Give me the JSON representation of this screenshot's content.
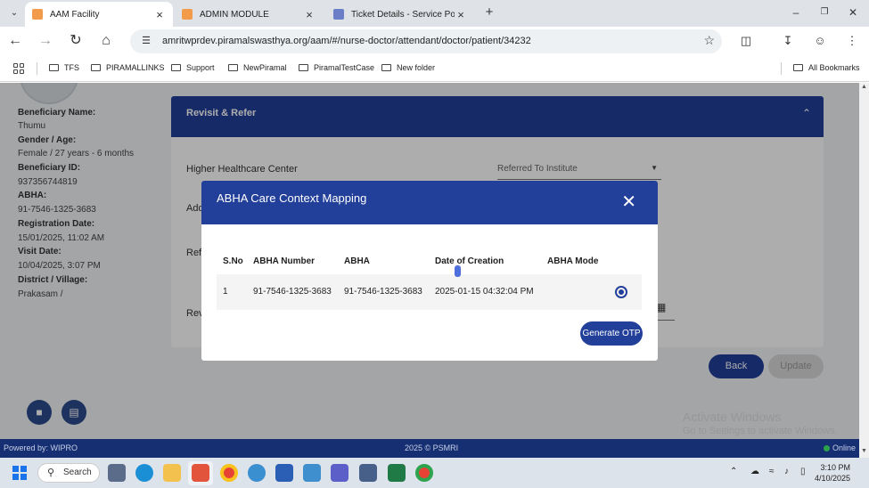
{
  "browser": {
    "tabs": [
      {
        "title": "AAM Facility",
        "active": true
      },
      {
        "title": "ADMIN MODULE",
        "active": false
      },
      {
        "title": "Ticket Details - Service Porta",
        "active": false
      }
    ],
    "url": "amritwprdev.piramalswasthya.org/aam/#/nurse-doctor/attendant/doctor/patient/34232",
    "bookmarks": [
      "TFS",
      "PIRAMALLINKS",
      "Support",
      "NewPiramal",
      "PiramalTestCase",
      "New folder"
    ],
    "all_bookmarks": "All Bookmarks"
  },
  "patient": {
    "beneficiary_name_label": "Beneficiary Name:",
    "beneficiary_name": "Thumu",
    "gender_age_label": "Gender / Age:",
    "gender_age": "Female / 27 years - 6 months",
    "beneficiary_id_label": "Beneficiary ID:",
    "beneficiary_id": "937356744819",
    "abha_label": "ABHA:",
    "abha": "91-7546-1325-3683",
    "registration_date_label": "Registration Date:",
    "registration_date": "15/01/2025, 11:02 AM",
    "visit_date_label": "Visit Date:",
    "visit_date": "10/04/2025, 3:07 PM",
    "district_label": "District / Village:",
    "district": "Prakasam /"
  },
  "refer": {
    "title": "Revisit & Refer",
    "higher_center_label": "Higher Healthcare Center",
    "referred_placeholder": "Referred To Institute",
    "partial_label_1": "Add",
    "partial_label_2": "Refe",
    "partial_label_3": "Rev",
    "back": "Back",
    "update": "Update"
  },
  "modal": {
    "title": "ABHA Care Context Mapping",
    "close": "✕",
    "columns": [
      "S.No",
      "ABHA Number",
      "ABHA",
      "Date of Creation",
      "ABHA Mode"
    ],
    "rows": [
      {
        "sno": "1",
        "abha_number": "91-7546-1325-3683",
        "abha": "91-7546-1325-3683",
        "date": "2025-01-15 04:32:04 PM",
        "mode": "",
        "selected": true
      }
    ],
    "generate_otp": "Generate OTP"
  },
  "watermark": {
    "line1": "Activate Windows",
    "line2": "Go to Settings to activate Windows."
  },
  "footer": {
    "powered_by": "Powered by: WIPRO",
    "copyright": "2025 © PSMRI",
    "status": "Online"
  },
  "taskbar": {
    "search": "Search",
    "time": "3:10 PM",
    "date": "4/10/2025"
  },
  "colors": {
    "primary": "#223f9a",
    "footer": "#162f73",
    "online": "#2ca24a"
  }
}
